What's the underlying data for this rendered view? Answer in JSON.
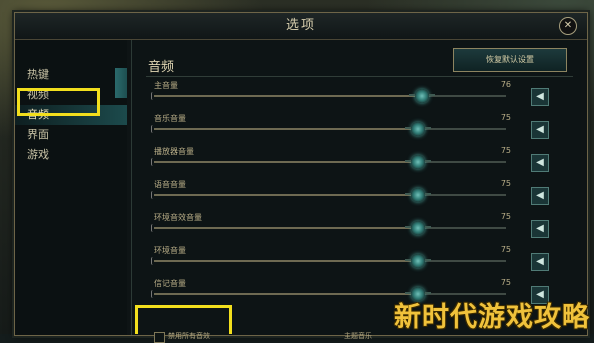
{
  "window": {
    "title": "选项",
    "close_icon": "close-icon"
  },
  "sidebar": {
    "items": [
      {
        "label": "热键"
      },
      {
        "label": "视频"
      },
      {
        "label": "音频"
      },
      {
        "label": "界面"
      },
      {
        "label": "游戏"
      }
    ],
    "active_index": 2
  },
  "content": {
    "title": "音频",
    "restore_button": "恢复默认设置",
    "sliders": [
      {
        "label": "主音量",
        "value": "76",
        "level": 76
      },
      {
        "label": "音乐音量",
        "value": "75",
        "level": 75
      },
      {
        "label": "播放器音量",
        "value": "75",
        "level": 75
      },
      {
        "label": "语音音量",
        "value": "75",
        "level": 75
      },
      {
        "label": "环境音效音量",
        "value": "75",
        "level": 75
      },
      {
        "label": "环境音量",
        "value": "75",
        "level": 75
      },
      {
        "label": "信记音量",
        "value": "75",
        "level": 75
      }
    ],
    "footer_checkbox_label": "禁用所有音效",
    "footer_right_label": "主题音乐"
  },
  "watermark": "新时代游戏攻略",
  "colors": {
    "highlight": "#f2df1d",
    "accent": "#1c4a4c",
    "knob": "#49a59d"
  }
}
